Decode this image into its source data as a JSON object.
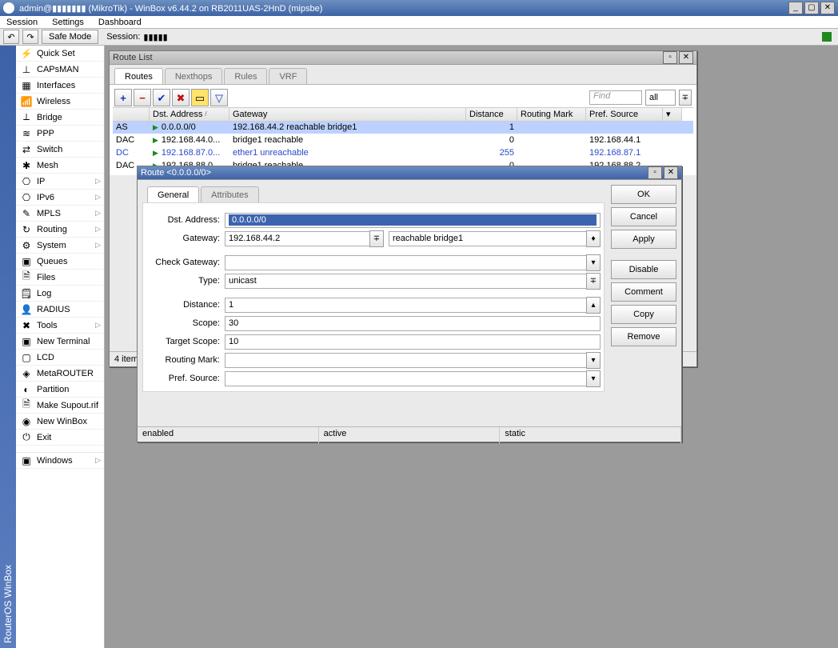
{
  "titlebar": {
    "user_host": "admin@▮▮▮▮▮▮▮ (MikroTik) - WinBox v6.44.2 on RB2011UAS-2HnD (mipsbe)"
  },
  "menu": {
    "session": "Session",
    "settings": "Settings",
    "dashboard": "Dashboard"
  },
  "toolbar": {
    "safe_mode": "Safe Mode",
    "session_label": "Session:",
    "session_value": "▮▮▮▮▮",
    "undo": "↶",
    "redo": "↷"
  },
  "sidestrip": "RouterOS WinBox",
  "sidebar": {
    "items": [
      {
        "icon": "⚡",
        "label": "Quick Set",
        "chev": false
      },
      {
        "icon": "⊥",
        "label": "CAPsMAN",
        "chev": false
      },
      {
        "icon": "▦",
        "label": "Interfaces",
        "chev": false
      },
      {
        "icon": "📶",
        "label": "Wireless",
        "chev": false
      },
      {
        "icon": "⟂",
        "label": "Bridge",
        "chev": false
      },
      {
        "icon": "≋",
        "label": "PPP",
        "chev": false
      },
      {
        "icon": "⇄",
        "label": "Switch",
        "chev": false
      },
      {
        "icon": "✱",
        "label": "Mesh",
        "chev": false
      },
      {
        "icon": "⎔",
        "label": "IP",
        "chev": true
      },
      {
        "icon": "⎔",
        "label": "IPv6",
        "chev": true
      },
      {
        "icon": "✎",
        "label": "MPLS",
        "chev": true
      },
      {
        "icon": "↻",
        "label": "Routing",
        "chev": true
      },
      {
        "icon": "⚙",
        "label": "System",
        "chev": true
      },
      {
        "icon": "▣",
        "label": "Queues",
        "chev": false
      },
      {
        "icon": "🗎",
        "label": "Files",
        "chev": false
      },
      {
        "icon": "🗒",
        "label": "Log",
        "chev": false
      },
      {
        "icon": "👤",
        "label": "RADIUS",
        "chev": false
      },
      {
        "icon": "✖",
        "label": "Tools",
        "chev": true
      },
      {
        "icon": "▣",
        "label": "New Terminal",
        "chev": false
      },
      {
        "icon": "▢",
        "label": "LCD",
        "chev": false
      },
      {
        "icon": "◈",
        "label": "MetaROUTER",
        "chev": false
      },
      {
        "icon": "◐",
        "label": "Partition",
        "chev": false
      },
      {
        "icon": "🗎",
        "label": "Make Supout.rif",
        "chev": false
      },
      {
        "icon": "◉",
        "label": "New WinBox",
        "chev": false
      },
      {
        "icon": "⏻",
        "label": "Exit",
        "chev": false
      }
    ],
    "windows_label": "Windows"
  },
  "routelist": {
    "title": "Route List",
    "tabs": {
      "routes": "Routes",
      "nexthops": "Nexthops",
      "rules": "Rules",
      "vrf": "VRF"
    },
    "find": "Find",
    "all": "all",
    "columns": {
      "flags": "",
      "dst": "Dst. Address",
      "gateway": "Gateway",
      "distance": "Distance",
      "routing_mark": "Routing Mark",
      "pref_source": "Pref. Source"
    },
    "rows": [
      {
        "flags": "AS",
        "dst": "0.0.0.0/0",
        "gw": "192.168.44.2 reachable bridge1",
        "dist": "1",
        "mark": "",
        "pref": "",
        "selected": true,
        "blue": false
      },
      {
        "flags": "DAC",
        "dst": "192.168.44.0...",
        "gw": "bridge1 reachable",
        "dist": "0",
        "mark": "",
        "pref": "192.168.44.1",
        "selected": false,
        "blue": false
      },
      {
        "flags": "DC",
        "dst": "192.168.87.0...",
        "gw": "ether1 unreachable",
        "dist": "255",
        "mark": "",
        "pref": "192.168.87.1",
        "selected": false,
        "blue": true
      },
      {
        "flags": "DAC",
        "dst": "192.168.88.0...",
        "gw": "bridge1 reachable",
        "dist": "0",
        "mark": "",
        "pref": "192.168.88.2",
        "selected": false,
        "blue": false
      }
    ],
    "status": "4 item"
  },
  "routedet": {
    "title": "Route <0.0.0.0/0>",
    "tabs": {
      "general": "General",
      "attributes": "Attributes"
    },
    "buttons": {
      "ok": "OK",
      "cancel": "Cancel",
      "apply": "Apply",
      "disable": "Disable",
      "comment": "Comment",
      "copy": "Copy",
      "remove": "Remove"
    },
    "labels": {
      "dst_address": "Dst. Address:",
      "gateway": "Gateway:",
      "check_gateway": "Check Gateway:",
      "type": "Type:",
      "distance": "Distance:",
      "scope": "Scope:",
      "target_scope": "Target Scope:",
      "routing_mark": "Routing Mark:",
      "pref_source": "Pref. Source:"
    },
    "values": {
      "dst_address": "0.0.0.0/0",
      "gateway": "192.168.44.2",
      "gateway_status": "reachable bridge1",
      "check_gateway": "",
      "type": "unicast",
      "distance": "1",
      "scope": "30",
      "target_scope": "10",
      "routing_mark": "",
      "pref_source": ""
    },
    "status": {
      "enabled": "enabled",
      "active": "active",
      "static": "static"
    }
  }
}
